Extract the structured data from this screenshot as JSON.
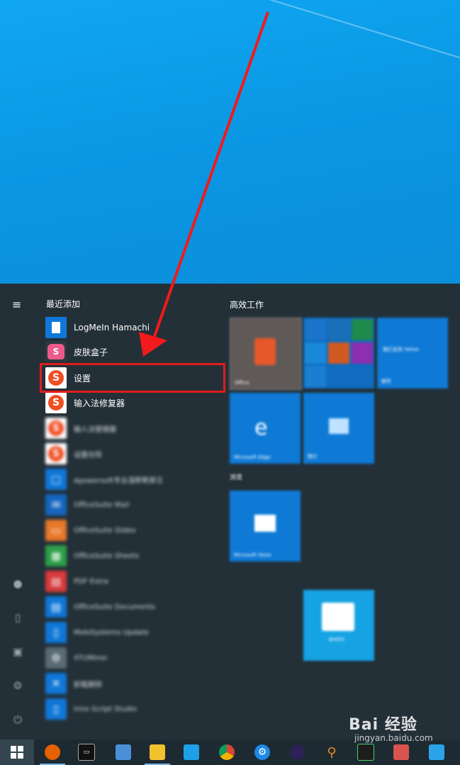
{
  "start_menu": {
    "recent_header": "最近添加",
    "productivity_header": "高效工作",
    "browse_header": "浏览",
    "apps": [
      {
        "label": "LogMeIn Hamachi",
        "icon": "file-icon"
      },
      {
        "label": "皮肤盒子",
        "icon": "skin-box-icon"
      },
      {
        "label": "设置",
        "icon": "sogou-icon"
      },
      {
        "label": "输入法修复器",
        "icon": "sogou-icon"
      },
      {
        "label": "输入法管理器",
        "icon": "sogou-icon"
      },
      {
        "label": "设置向导",
        "icon": "sogou-icon"
      },
      {
        "label": "Apowersoft专业温断断屏王",
        "icon": "apowersoft-icon"
      },
      {
        "label": "OfficeSuite Mail",
        "icon": "mail-icon"
      },
      {
        "label": "OfficeSuite Slides",
        "icon": "slides-icon"
      },
      {
        "label": "OfficeSuite Sheets",
        "icon": "sheets-icon"
      },
      {
        "label": "PDF Extra",
        "icon": "pdf-icon"
      },
      {
        "label": "OfficeSuite Documents",
        "icon": "documents-icon"
      },
      {
        "label": "MobiSystems Update",
        "icon": "update-icon"
      },
      {
        "label": "XTUMiner",
        "icon": "gear-icon"
      },
      {
        "label": "卸载删除",
        "icon": "uninstall-icon"
      },
      {
        "label": "Inno Script Studio",
        "icon": "file-icon"
      }
    ],
    "tiles": {
      "office": "Office",
      "mail_wide": "我们支持 Yahoo",
      "mail": "邮件",
      "edge": "Microsoft Edge",
      "photos": "照片",
      "store": "Microsoft Store",
      "baidu": "BAIDU"
    }
  },
  "watermark": {
    "brand": "Bai 经验",
    "url": "jingyan.baidu.com"
  }
}
